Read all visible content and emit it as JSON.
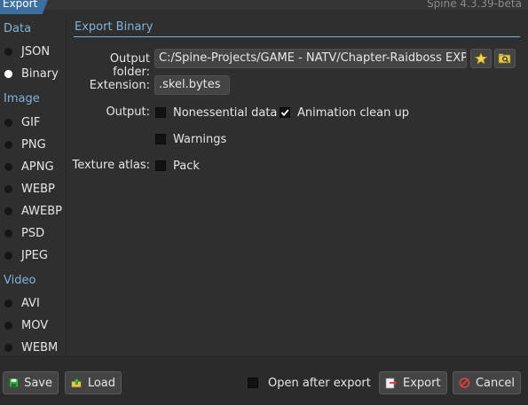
{
  "window": {
    "title": "Export",
    "version": "Spine 4.3.39-beta"
  },
  "sidebar": {
    "data_header": "Data",
    "data_items": [
      {
        "label": "JSON",
        "selected": false
      },
      {
        "label": "Binary",
        "selected": true
      }
    ],
    "image_header": "Image",
    "image_items": [
      {
        "label": "GIF"
      },
      {
        "label": "PNG"
      },
      {
        "label": "APNG"
      },
      {
        "label": "WEBP"
      },
      {
        "label": "AWEBP"
      },
      {
        "label": "PSD"
      },
      {
        "label": "JPEG"
      }
    ],
    "video_header": "Video",
    "video_items": [
      {
        "label": "AVI"
      },
      {
        "label": "MOV"
      },
      {
        "label": "WEBM"
      }
    ]
  },
  "panel": {
    "title": "Export Binary",
    "output_folder_label": "Output folder:",
    "output_folder_value": "C:/Spine-Projects/GAME - NATV/Chapter-Raidboss EXPO",
    "extension_label": "Extension:",
    "extension_value": ".skel.bytes",
    "output_label": "Output:",
    "nonessential_label": "Nonessential data",
    "nonessential_checked": false,
    "animation_cleanup_label": "Animation clean up",
    "animation_cleanup_checked": true,
    "warnings_label": "Warnings",
    "warnings_checked": false,
    "texture_atlas_label": "Texture atlas:",
    "pack_label": "Pack",
    "pack_checked": false
  },
  "footer": {
    "save_label": "Save",
    "load_label": "Load",
    "open_after_export_label": "Open after export",
    "open_after_export_checked": false,
    "export_label": "Export",
    "cancel_label": "Cancel"
  },
  "colors": {
    "accent": "#7fb3dc",
    "title_tab": "#3d6f9e",
    "background": "#2f2f2f"
  }
}
